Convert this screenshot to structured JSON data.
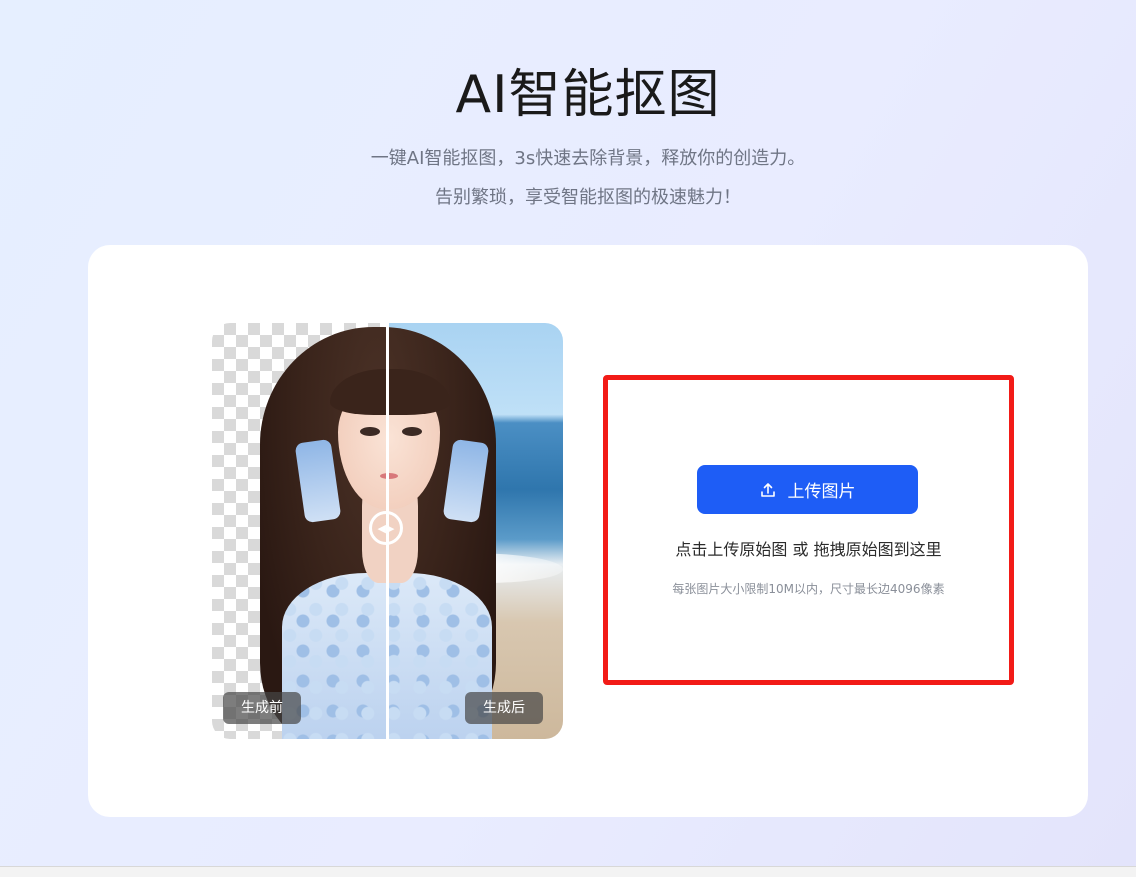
{
  "header": {
    "title": "AI智能抠图",
    "subtitle_line1": "一键AI智能抠图，3s快速去除背景，释放你的创造力。",
    "subtitle_line2": "告别繁琐，享受智能抠图的极速魅力！"
  },
  "compare": {
    "before_label": "生成前",
    "after_label": "生成后",
    "handle_icon": "left-right-arrows-icon"
  },
  "upload": {
    "button_label": "上传图片",
    "button_icon": "upload-icon",
    "hint": "点击上传原始图 或 拖拽原始图到这里",
    "limit": "每张图片大小限制10M以内，尺寸最长边4096像素",
    "accent_color": "#1e5df6",
    "highlight_color": "#f21b17"
  }
}
